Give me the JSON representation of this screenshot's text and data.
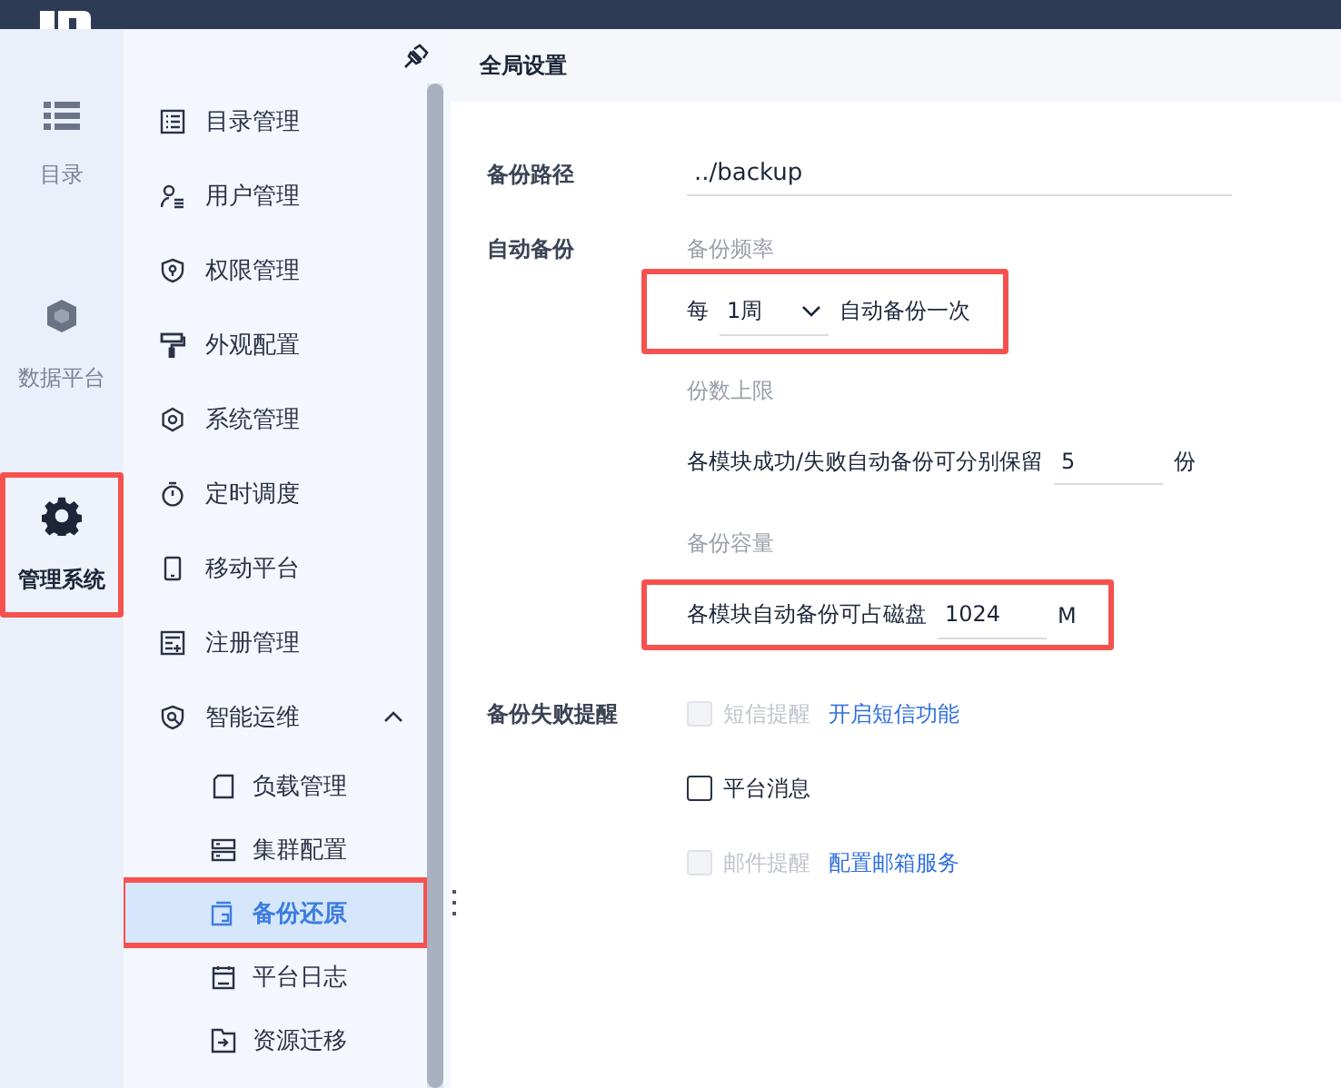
{
  "rail": [
    {
      "label": "目录",
      "selected": false,
      "highlighted": false
    },
    {
      "label": "数据平台",
      "selected": false,
      "highlighted": false
    },
    {
      "label": "管理系统",
      "selected": true,
      "highlighted": true
    }
  ],
  "menu": {
    "items": [
      {
        "label": "目录管理",
        "selected": false
      },
      {
        "label": "用户管理",
        "selected": false
      },
      {
        "label": "权限管理",
        "selected": false
      },
      {
        "label": "外观配置",
        "selected": false
      },
      {
        "label": "系统管理",
        "selected": false
      },
      {
        "label": "定时调度",
        "selected": false
      },
      {
        "label": "移动平台",
        "selected": false
      },
      {
        "label": "注册管理",
        "selected": false
      },
      {
        "label": "智能运维",
        "selected": false,
        "expanded": true,
        "children": [
          {
            "label": "负载管理",
            "selected": false,
            "highlighted": false
          },
          {
            "label": "集群配置",
            "selected": false,
            "highlighted": false
          },
          {
            "label": "备份还原",
            "selected": true,
            "highlighted": true
          },
          {
            "label": "平台日志",
            "selected": false,
            "highlighted": false
          },
          {
            "label": "资源迁移",
            "selected": false,
            "highlighted": false
          }
        ]
      }
    ]
  },
  "page": {
    "title": "全局设置"
  },
  "form": {
    "backup_path": {
      "label": "备份路径",
      "value": "../backup"
    },
    "auto_backup": {
      "label": "自动备份",
      "frequency": {
        "caption": "备份频率",
        "prefix": "每",
        "select_value": "1周",
        "suffix": "自动备份一次",
        "highlighted": true
      },
      "copies": {
        "caption": "份数上限",
        "text": "各模块成功/失败自动备份可分别保留",
        "value": "5",
        "unit": "份",
        "highlighted": false
      },
      "capacity": {
        "caption": "备份容量",
        "text": "各模块自动备份可占磁盘",
        "value": "1024",
        "unit": "M",
        "highlighted": true
      }
    },
    "failure_alert": {
      "label": "备份失败提醒",
      "options": [
        {
          "label": "短信提醒",
          "checked": false,
          "disabled": true,
          "link": "开启短信功能"
        },
        {
          "label": "平台消息",
          "checked": false,
          "disabled": false
        },
        {
          "label": "邮件提醒",
          "checked": false,
          "disabled": true,
          "link": "配置邮箱服务"
        }
      ]
    }
  }
}
